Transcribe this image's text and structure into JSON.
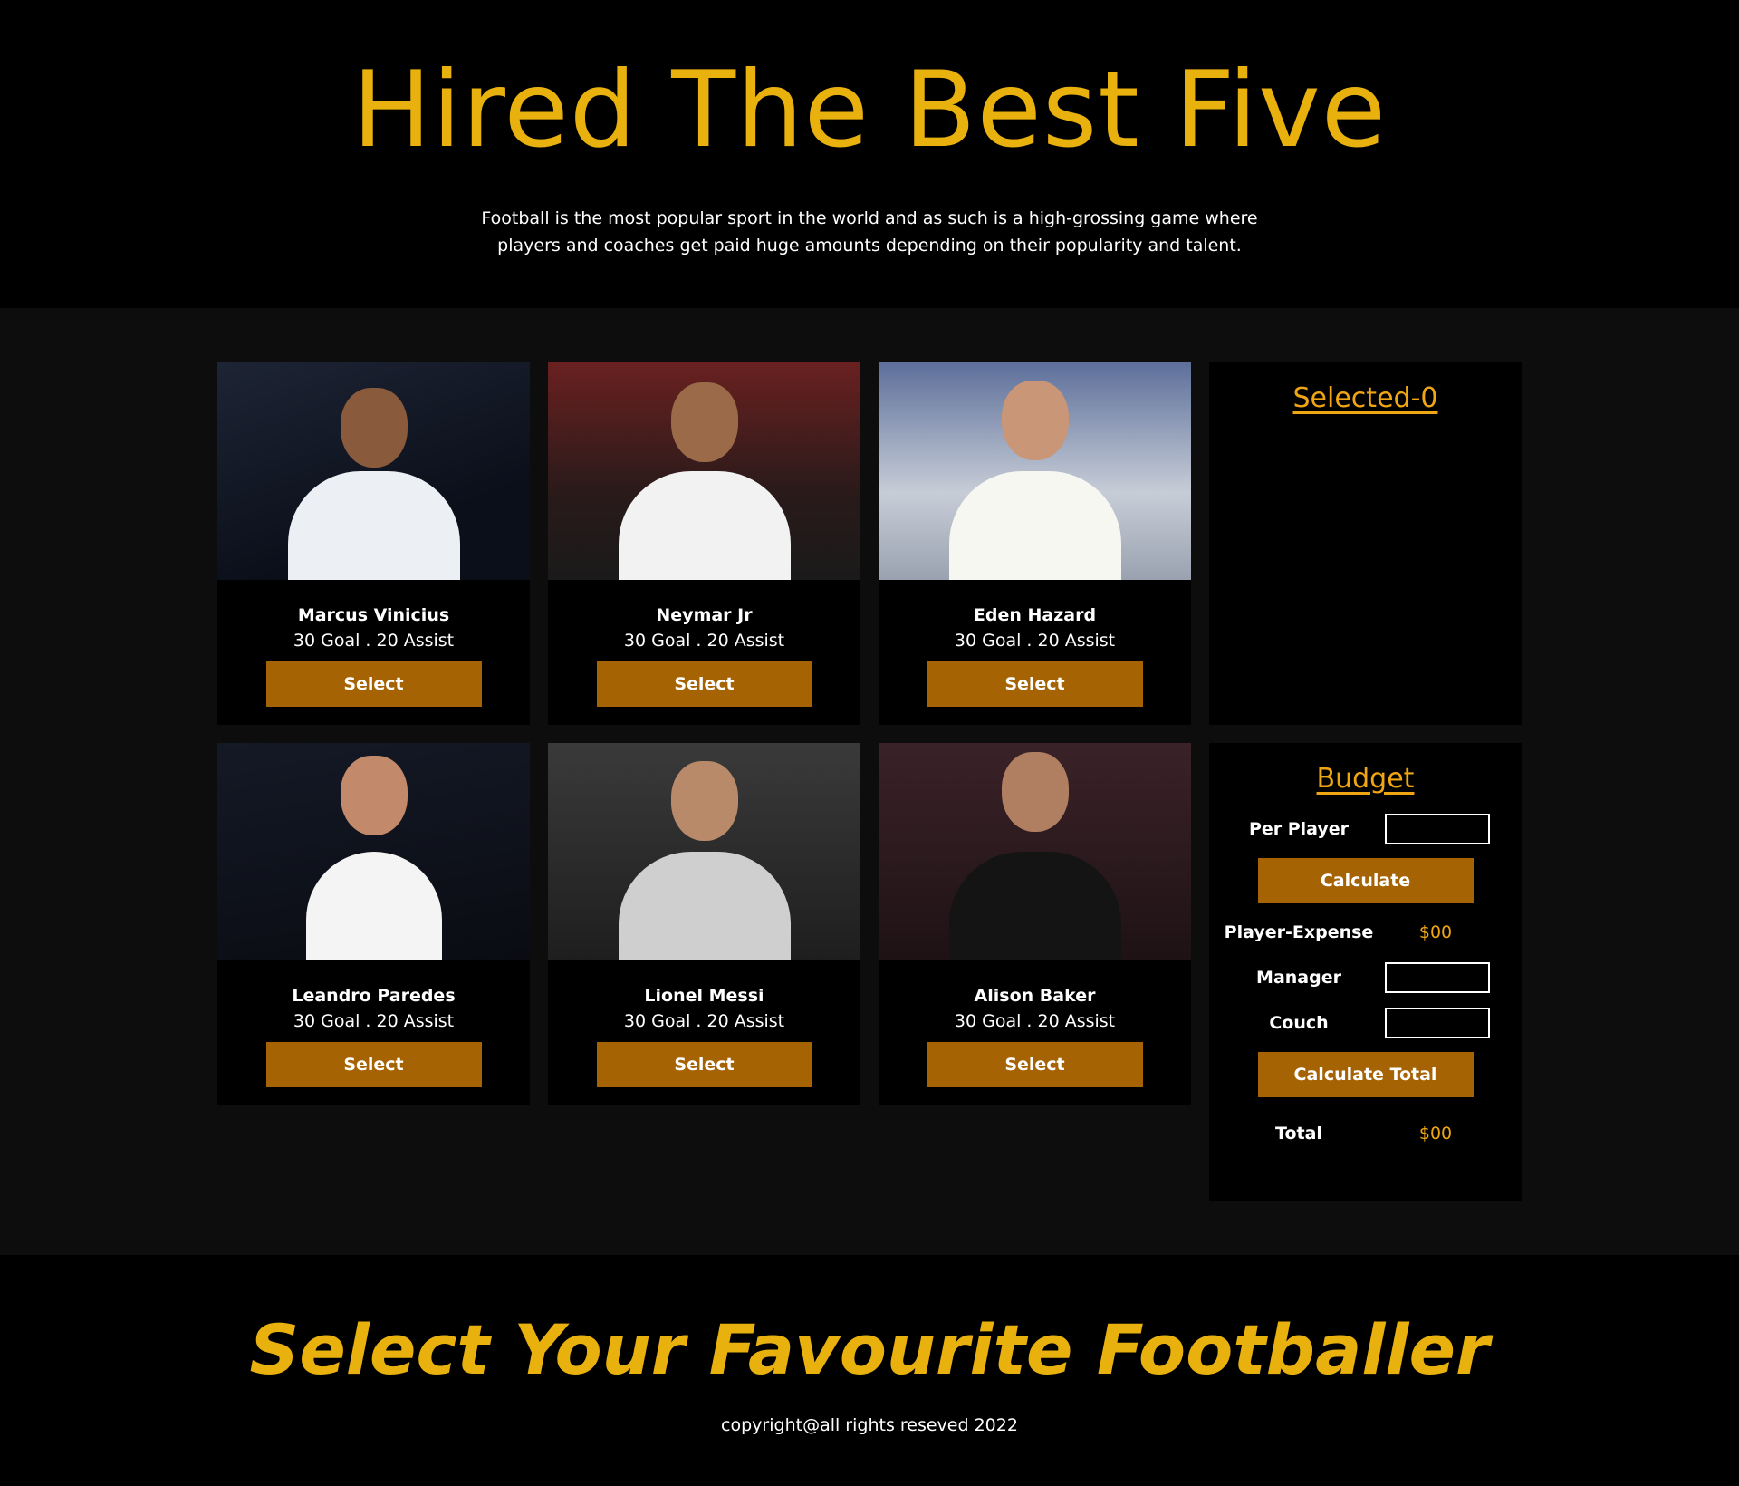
{
  "hero": {
    "title": "Hired The Best Five",
    "subtitle": "Football is the most popular sport in the world and as such is a high-grossing game where players and coaches get paid huge amounts depending on their popularity and talent."
  },
  "players": [
    {
      "name": "Marcus Vinicius",
      "stats": "30 Goal . 20 Assist",
      "button": "Select"
    },
    {
      "name": "Neymar Jr",
      "stats": "30 Goal . 20 Assist",
      "button": "Select"
    },
    {
      "name": "Eden Hazard",
      "stats": "30 Goal . 20 Assist",
      "button": "Select"
    },
    {
      "name": "Leandro Paredes",
      "stats": "30 Goal . 20 Assist",
      "button": "Select"
    },
    {
      "name": "Lionel Messi",
      "stats": "30 Goal . 20 Assist",
      "button": "Select"
    },
    {
      "name": "Alison Baker",
      "stats": "30 Goal . 20 Assist",
      "button": "Select"
    }
  ],
  "selected": {
    "title": "Selected-0"
  },
  "budget": {
    "title": "Budget",
    "per_player_label": "Per Player",
    "calculate_label": "Calculate",
    "player_expense_label": "Player-Expense",
    "player_expense_value": "$00",
    "manager_label": "Manager",
    "couch_label": "Couch",
    "calculate_total_label": "Calculate Total",
    "total_label": "Total",
    "total_value": "$00"
  },
  "footer": {
    "title": "Select Your Favourite Footballer",
    "copyright": "copyright@all rights reseved 2022"
  },
  "colors": {
    "accent": "#e9b10e",
    "button": "#a56303",
    "value": "#f0a512"
  }
}
